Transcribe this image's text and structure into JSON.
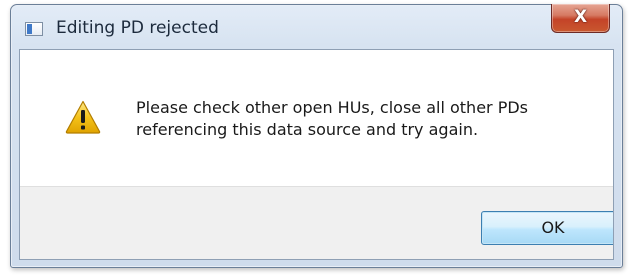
{
  "dialog": {
    "title": "Editing PD rejected",
    "close_label": "X",
    "message_lines": [
      "Please check other open HUs, close all other PDs",
      "referencing this data source and try again."
    ],
    "ok_label": "OK"
  },
  "icons": {
    "app": "application-window-icon",
    "warning": "warning-triangle-icon",
    "close": "close-icon"
  },
  "colors": {
    "close_button": "#c44328",
    "ok_button_border": "#3c7fb1",
    "warning_fill": "#f5c21a"
  }
}
